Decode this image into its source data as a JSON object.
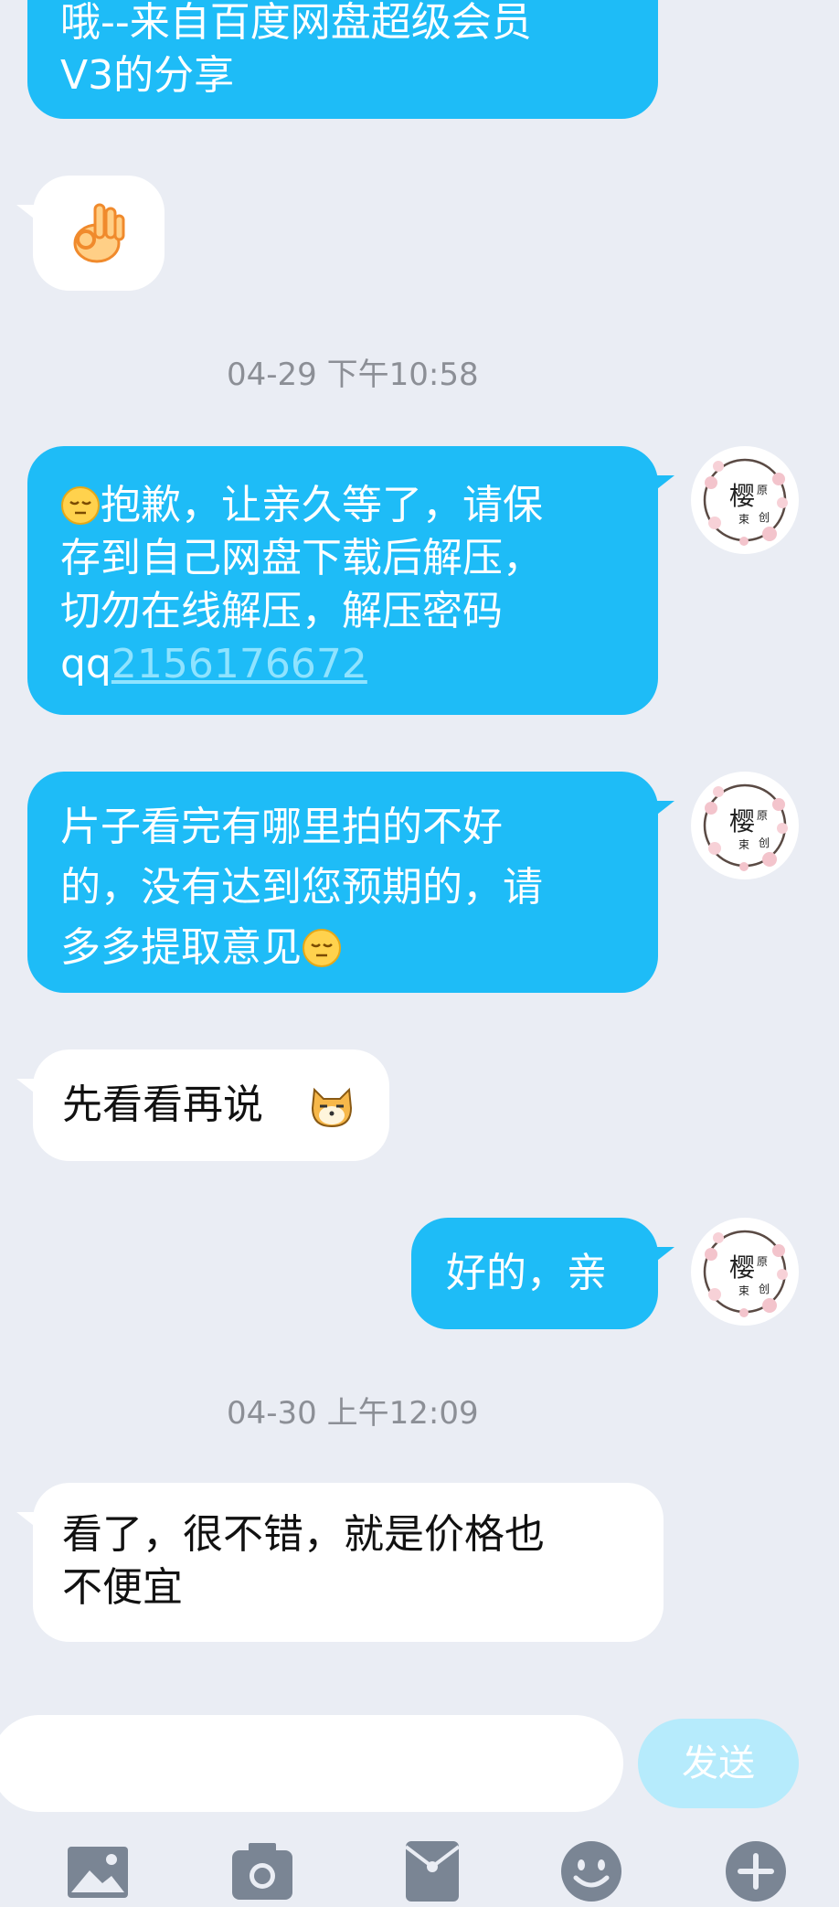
{
  "messages": [
    {
      "side": "out",
      "lines": [
        "哦--来自百度网盘超级会员",
        "V3的分享"
      ]
    },
    {
      "side": "in",
      "emoji": "ok-hand-emoji"
    },
    {
      "side": "out",
      "text_line1": "抱歉，让亲久等了，请保",
      "text_line2": "存到自己网盘下载后解压，",
      "text_line3": "切勿在线解压，解压密码",
      "text_line4_prefix": "qq",
      "text_line4_link": "2156176672"
    },
    {
      "side": "out",
      "text_line1": "片子看完有哪里拍的不好",
      "text_line2": "的，没有达到您预期的，请",
      "text_line3": "多多提取意见"
    },
    {
      "side": "in",
      "text": "先看看再说"
    },
    {
      "side": "out",
      "text": "好的，亲"
    },
    {
      "side": "in",
      "text_line1": "看了，很不错，就是价格也",
      "text_line2": "不便宜"
    }
  ],
  "timestamps": {
    "first": "04-29 下午10:58",
    "second": "04-30 上午12:09"
  },
  "avatar": {
    "char_big": "樱",
    "char_small_1": "原",
    "char_small_2": "束",
    "char_small_3": "创"
  },
  "input": {
    "value": "",
    "send_label": "发送"
  },
  "toolbar": {
    "icons": [
      "image-icon",
      "camera-icon",
      "red-packet-icon",
      "emoji-icon",
      "plus-icon"
    ]
  },
  "colors": {
    "outgoing_bubble": "#1ebcf7",
    "incoming_bubble": "#ffffff",
    "background": "#eaedf4",
    "send_button_disabled": "#b6ebfc"
  }
}
